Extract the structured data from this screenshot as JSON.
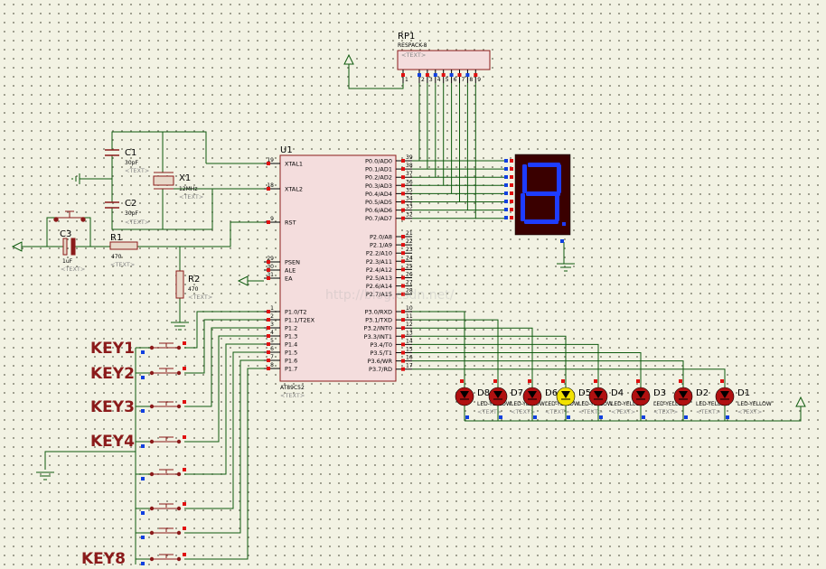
{
  "mcu": {
    "ref": "U1",
    "part": "AT89C52",
    "text_tag": "<TEXT>",
    "left_pins": [
      {
        "num": "19",
        "name": "XTAL1"
      },
      {
        "num": "18",
        "name": "XTAL2"
      },
      {
        "num": "9",
        "name": "RST"
      },
      {
        "num": "29",
        "name": "PSEN"
      },
      {
        "num": "30",
        "name": "ALE"
      },
      {
        "num": "31",
        "name": "EA"
      },
      {
        "num": "1",
        "name": "P1.0/T2"
      },
      {
        "num": "2",
        "name": "P1.1/T2EX"
      },
      {
        "num": "3",
        "name": "P1.2"
      },
      {
        "num": "4",
        "name": "P1.3"
      },
      {
        "num": "5",
        "name": "P1.4"
      },
      {
        "num": "6",
        "name": "P1.5"
      },
      {
        "num": "7",
        "name": "P1.6"
      },
      {
        "num": "8",
        "name": "P1.7"
      }
    ],
    "port0": [
      {
        "num": "39",
        "name": "P0.0/AD0"
      },
      {
        "num": "38",
        "name": "P0.1/AD1"
      },
      {
        "num": "37",
        "name": "P0.2/AD2"
      },
      {
        "num": "36",
        "name": "P0.3/AD3"
      },
      {
        "num": "35",
        "name": "P0.4/AD4"
      },
      {
        "num": "34",
        "name": "P0.5/AD5"
      },
      {
        "num": "33",
        "name": "P0.6/AD6"
      },
      {
        "num": "32",
        "name": "P0.7/AD7"
      }
    ],
    "port2": [
      {
        "num": "21",
        "name": "P2.0/A8"
      },
      {
        "num": "22",
        "name": "P2.1/A9"
      },
      {
        "num": "23",
        "name": "P2.2/A10"
      },
      {
        "num": "24",
        "name": "P2.3/A11"
      },
      {
        "num": "25",
        "name": "P2.4/A12"
      },
      {
        "num": "26",
        "name": "P2.5/A13"
      },
      {
        "num": "27",
        "name": "P2.6/A14"
      },
      {
        "num": "28",
        "name": "P2.7/A15"
      }
    ],
    "port3": [
      {
        "num": "10",
        "name": "P3.0/RXD"
      },
      {
        "num": "11",
        "name": "P3.1/TXD"
      },
      {
        "num": "12",
        "name": "P3.2/INT0"
      },
      {
        "num": "13",
        "name": "P3.3/INT1"
      },
      {
        "num": "14",
        "name": "P3.4/T0"
      },
      {
        "num": "15",
        "name": "P3.5/T1"
      },
      {
        "num": "16",
        "name": "P3.6/WR"
      },
      {
        "num": "17",
        "name": "P3.7/RD"
      }
    ]
  },
  "resnet": {
    "ref": "RP1",
    "part": "RESPACK-8",
    "text_tag": "<TEXT>",
    "pins": [
      "1",
      "2",
      "3",
      "4",
      "5",
      "6",
      "7",
      "8",
      "9"
    ]
  },
  "passives": {
    "c1": {
      "ref": "C1",
      "value": "30pF",
      "text_tag": "<TEXT>"
    },
    "c2": {
      "ref": "C2",
      "value": "30pF",
      "text_tag": "<TEXT>"
    },
    "c3": {
      "ref": "C3",
      "value": "1uF",
      "text_tag": "<TEXT>"
    },
    "x1": {
      "ref": "X1",
      "value": "12MHz",
      "text_tag": "<TEXT>"
    },
    "r1": {
      "ref": "R1",
      "value": "470",
      "text_tag": "<TEXT>"
    },
    "r2": {
      "ref": "R2",
      "value": "470",
      "text_tag": "<TEXT>"
    }
  },
  "display": {
    "digit": "8",
    "segment_color": "#1e3cff",
    "body_color": "#3a0000"
  },
  "keys": {
    "key1": "KEY1",
    "key2": "KEY2",
    "key3": "KEY3",
    "key4": "KEY4",
    "key8": "KEY8"
  },
  "leds": {
    "part_label": "LED-YELLOW",
    "text_tag": "<TEXT>",
    "items": [
      {
        "ref": "D8",
        "lit": false
      },
      {
        "ref": "D7",
        "lit": false
      },
      {
        "ref": "D6",
        "lit": false
      },
      {
        "ref": "D5",
        "lit": true
      },
      {
        "ref": "D4",
        "lit": false
      },
      {
        "ref": "D3",
        "lit": false
      },
      {
        "ref": "D2",
        "lit": false
      },
      {
        "ref": "D1",
        "lit": false
      }
    ],
    "off_color": "#b01010",
    "on_color": "#f2e200"
  },
  "watermark": "http://blog.csdn.net/",
  "colors": {
    "wire": "#0e5a0e",
    "component": "#8b1a1a",
    "pin_red": "#e01010",
    "pin_blue": "#1040e0",
    "chip_fill": "#f4dddd"
  }
}
